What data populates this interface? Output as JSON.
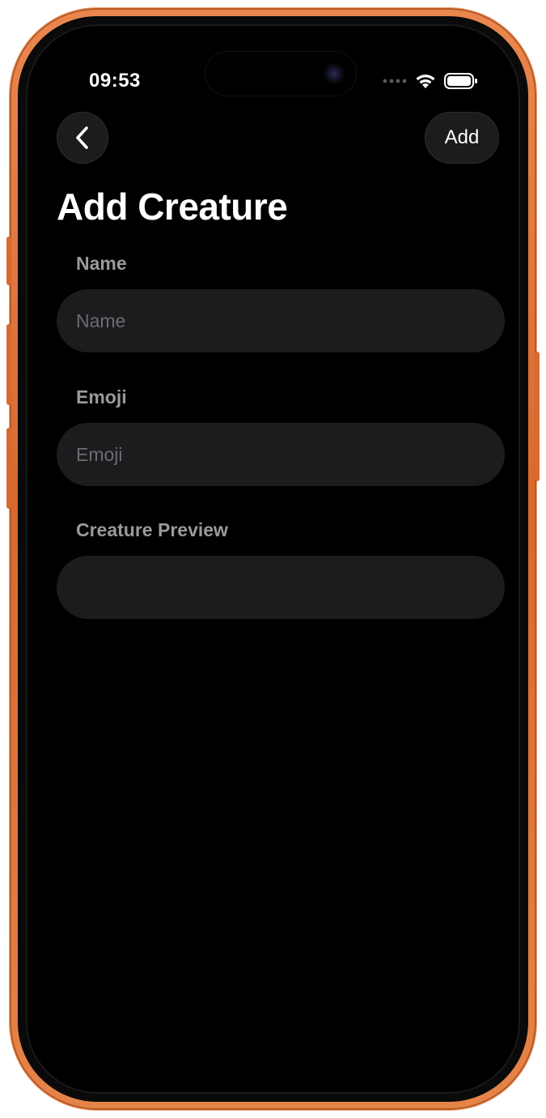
{
  "status_bar": {
    "time": "09:53"
  },
  "nav": {
    "add_label": "Add"
  },
  "page": {
    "title": "Add Creature"
  },
  "form": {
    "name_label": "Name",
    "name_placeholder": "Name",
    "name_value": "",
    "emoji_label": "Emoji",
    "emoji_placeholder": "Emoji",
    "emoji_value": "",
    "preview_label": "Creature Preview",
    "preview_value": ""
  },
  "colors": {
    "frame": "#e0763a",
    "background": "#000000",
    "field_background": "#1c1c1e",
    "label_gray": "#9a9a9e",
    "placeholder_gray": "#6b6b70"
  },
  "icons": {
    "back": "chevron-left-icon",
    "wifi": "wifi-icon",
    "battery": "battery-icon",
    "signal": "signal-dots-icon"
  }
}
